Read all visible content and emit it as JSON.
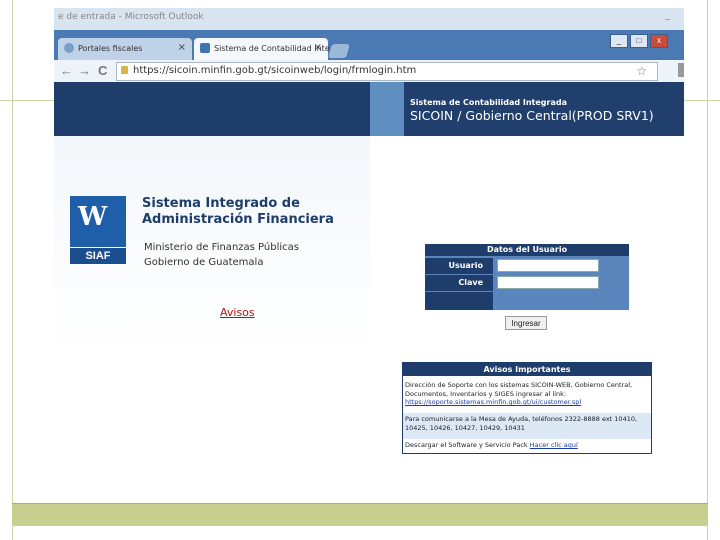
{
  "window": {
    "title": "e de entrada - Microsoft Outlook",
    "minimize_glyph": "_"
  },
  "tabs": [
    {
      "label": "Portales fiscales",
      "close": "×"
    },
    {
      "label": "Sistema de Contabilidad Inte",
      "close": "×"
    }
  ],
  "toolbar": {
    "back": "←",
    "forward": "→",
    "reload": "C",
    "url": "https://sicoin.minfin.gob.gt/sicoinweb/login/frmlogin.htm",
    "star": "☆"
  },
  "header": {
    "subtitle": "Sistema de Contabilidad Integrada",
    "title": "SICOIN / Gobierno Central(PROD SRV1)"
  },
  "brand": {
    "logo_text": "SIAF",
    "title_line1": "Sistema Integrado de",
    "title_line2": "Administración Financiera",
    "ministry_line1": "Ministerio de Finanzas Públicas",
    "ministry_line2": "Gobierno de Guatemala"
  },
  "avisos_link": "Avisos",
  "login": {
    "heading": "Datos del Usuario",
    "user_label": "Usuario",
    "password_label": "Clave",
    "user_value": "",
    "password_value": "",
    "submit": "Ingresar"
  },
  "notices": {
    "heading": "Avisos Importantes",
    "items": [
      {
        "text": "Dirección de Soporte con los sistemas SICOIN-WEB, Gobierno Central, Documentos, Inventarios y SIGES ingresar al link:",
        "link": "https://soporte.sistemas.minfin.gob.gt/ui/customer.spl"
      },
      {
        "text": "Para comunicarse a la Mesa de Ayuda, teléfonos 2322-8888 ext 10410, 10425, 10426, 10427, 10429, 10431",
        "link": ""
      },
      {
        "text": "Descargar el Software y Servicio Pack",
        "link": "Hacer clic aquí"
      }
    ]
  },
  "colors": {
    "header_navy": "#1f3d6b",
    "header_stripe": "#5e8fc0",
    "login_blue": "#5a86bd",
    "link_red": "#b01414",
    "slide_band": "#c7d08f"
  }
}
